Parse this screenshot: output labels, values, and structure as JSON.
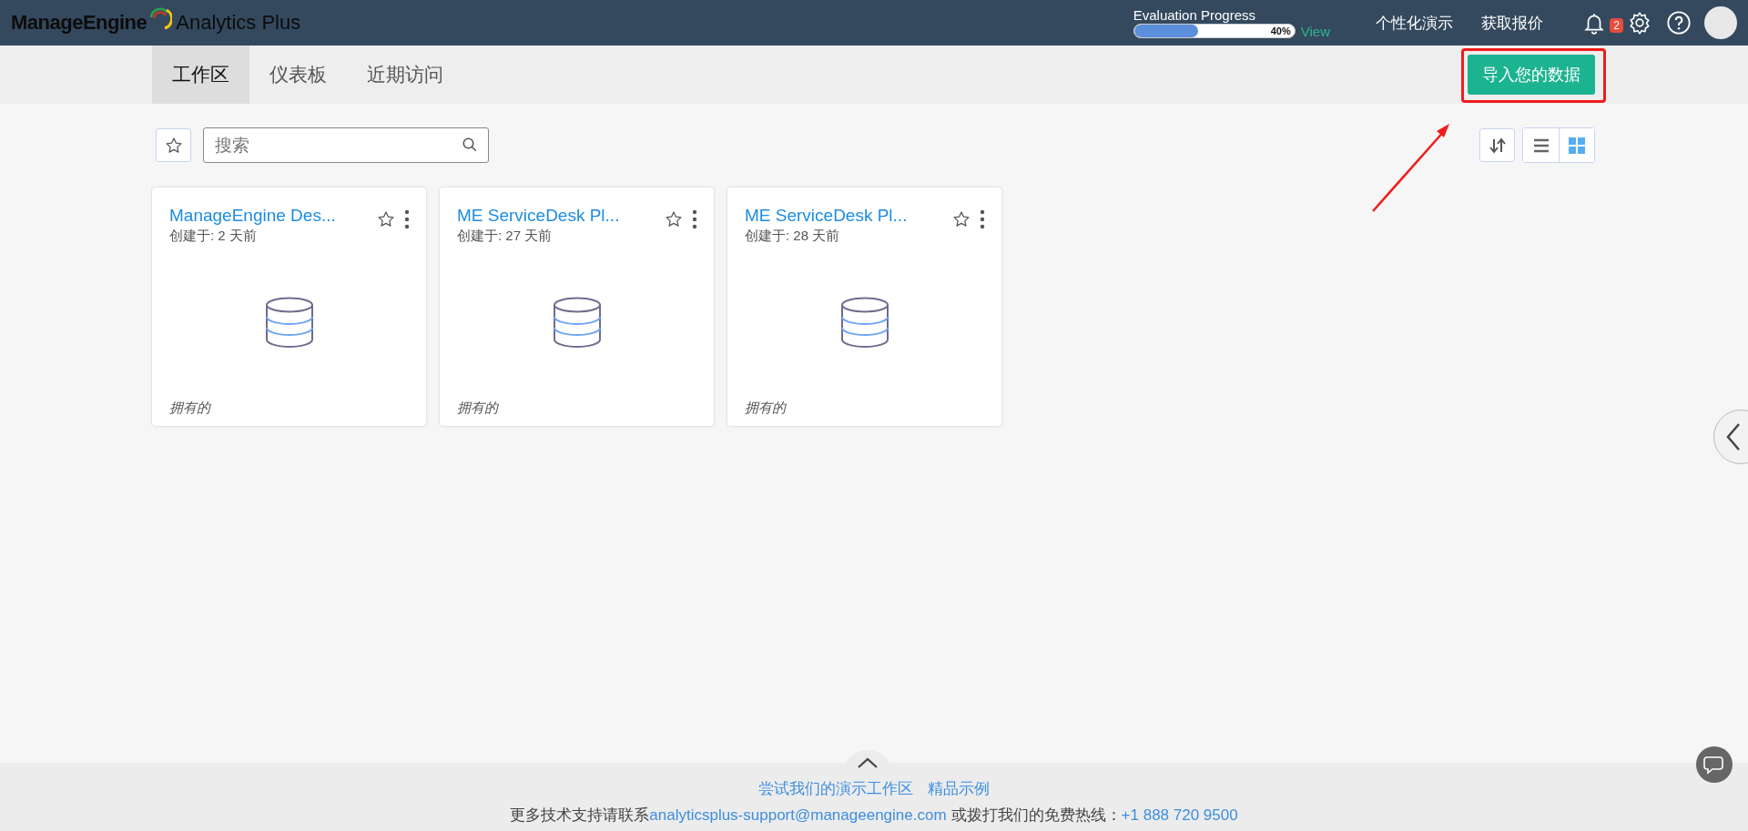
{
  "header": {
    "logo": {
      "brand": "ManageEngine",
      "product": "Analytics Plus"
    },
    "evaluation": {
      "title": "Evaluation Progress",
      "level": 0.4,
      "reading": "40%",
      "link": "View"
    },
    "links": [
      "个性化演示",
      "获取报价"
    ],
    "notifications": {
      "count": "2"
    }
  },
  "tabs": [
    {
      "label": "工作区",
      "selected": true
    },
    {
      "label": "仪表板",
      "selected": false
    },
    {
      "label": "近期访问",
      "selected": false
    }
  ],
  "import_button": "导入您的数据",
  "search": {
    "placeholder": "搜索"
  },
  "view_toggle": [
    {
      "kind": "list",
      "selected": false
    },
    {
      "kind": "grid",
      "selected": true
    }
  ],
  "workspaces": [
    {
      "name": "ManageEngine Des...",
      "created": "创建于: 2 天前",
      "ownership": "拥有的"
    },
    {
      "name": "ME ServiceDesk Pl...",
      "created": "创建于: 27 天前",
      "ownership": "拥有的"
    },
    {
      "name": "ME ServiceDesk Pl...",
      "created": "创建于: 28 天前",
      "ownership": "拥有的"
    }
  ],
  "footer": {
    "links": [
      "尝试我们的演示工作区",
      "精品示例"
    ],
    "contact_text": "更多技术支持请联系",
    "email": "analyticsplus-support@manageengine.com",
    "phone_text": "或拨打我们的免费热线：",
    "phone": "+1 888 720 9500"
  }
}
